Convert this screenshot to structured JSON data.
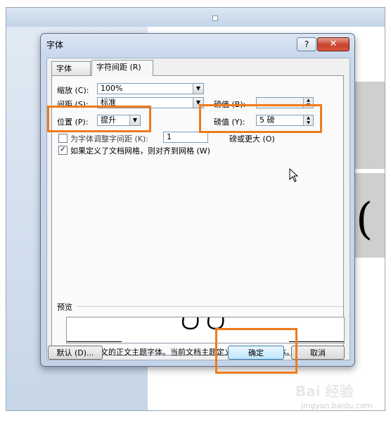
{
  "dialog": {
    "title": "字体",
    "help_label": "?",
    "close_label": "✕"
  },
  "tabs": [
    {
      "label": "字体 (N)"
    },
    {
      "label": "字符间距 (R)"
    }
  ],
  "spacing": {
    "scale_label": "缩放 (C):",
    "scale_value": "100%",
    "spacing_label": "间距 (S):",
    "spacing_value": "标准",
    "spacing_by_label": "磅值 (B):",
    "position_label": "位置 (P):",
    "position_value": "提升",
    "position_by_label": "磅值 (Y):",
    "position_by_value": "5 磅",
    "kerning_label": "为字体调整字间距 (K):",
    "kerning_value": "1",
    "kerning_suffix": "磅或更大 (O)",
    "grid_label": "如果定义了文档网格，则对齐到网格 (W)",
    "grid_checked": true
  },
  "preview": {
    "heading": "预览",
    "description": "这是用于中文的正文主题字体。当前文档主题定义将使用哪种字体。"
  },
  "buttons": {
    "default_label": "默认 (D)...",
    "ok_label": "确定",
    "cancel_label": "取消"
  },
  "background": {
    "paren": "(",
    "watermark_logo": "Bai 经验",
    "watermark_url": "jingyan.baidu.com"
  },
  "colors": {
    "highlight": "#f07a1c",
    "close_button": "#c7412c",
    "ok_button_border": "#3c7fb1"
  },
  "icons": [
    "help-icon",
    "close-icon",
    "dropdown-arrow-icon",
    "spin-arrows-icon",
    "checkmark-icon",
    "mouse-cursor-icon"
  ]
}
